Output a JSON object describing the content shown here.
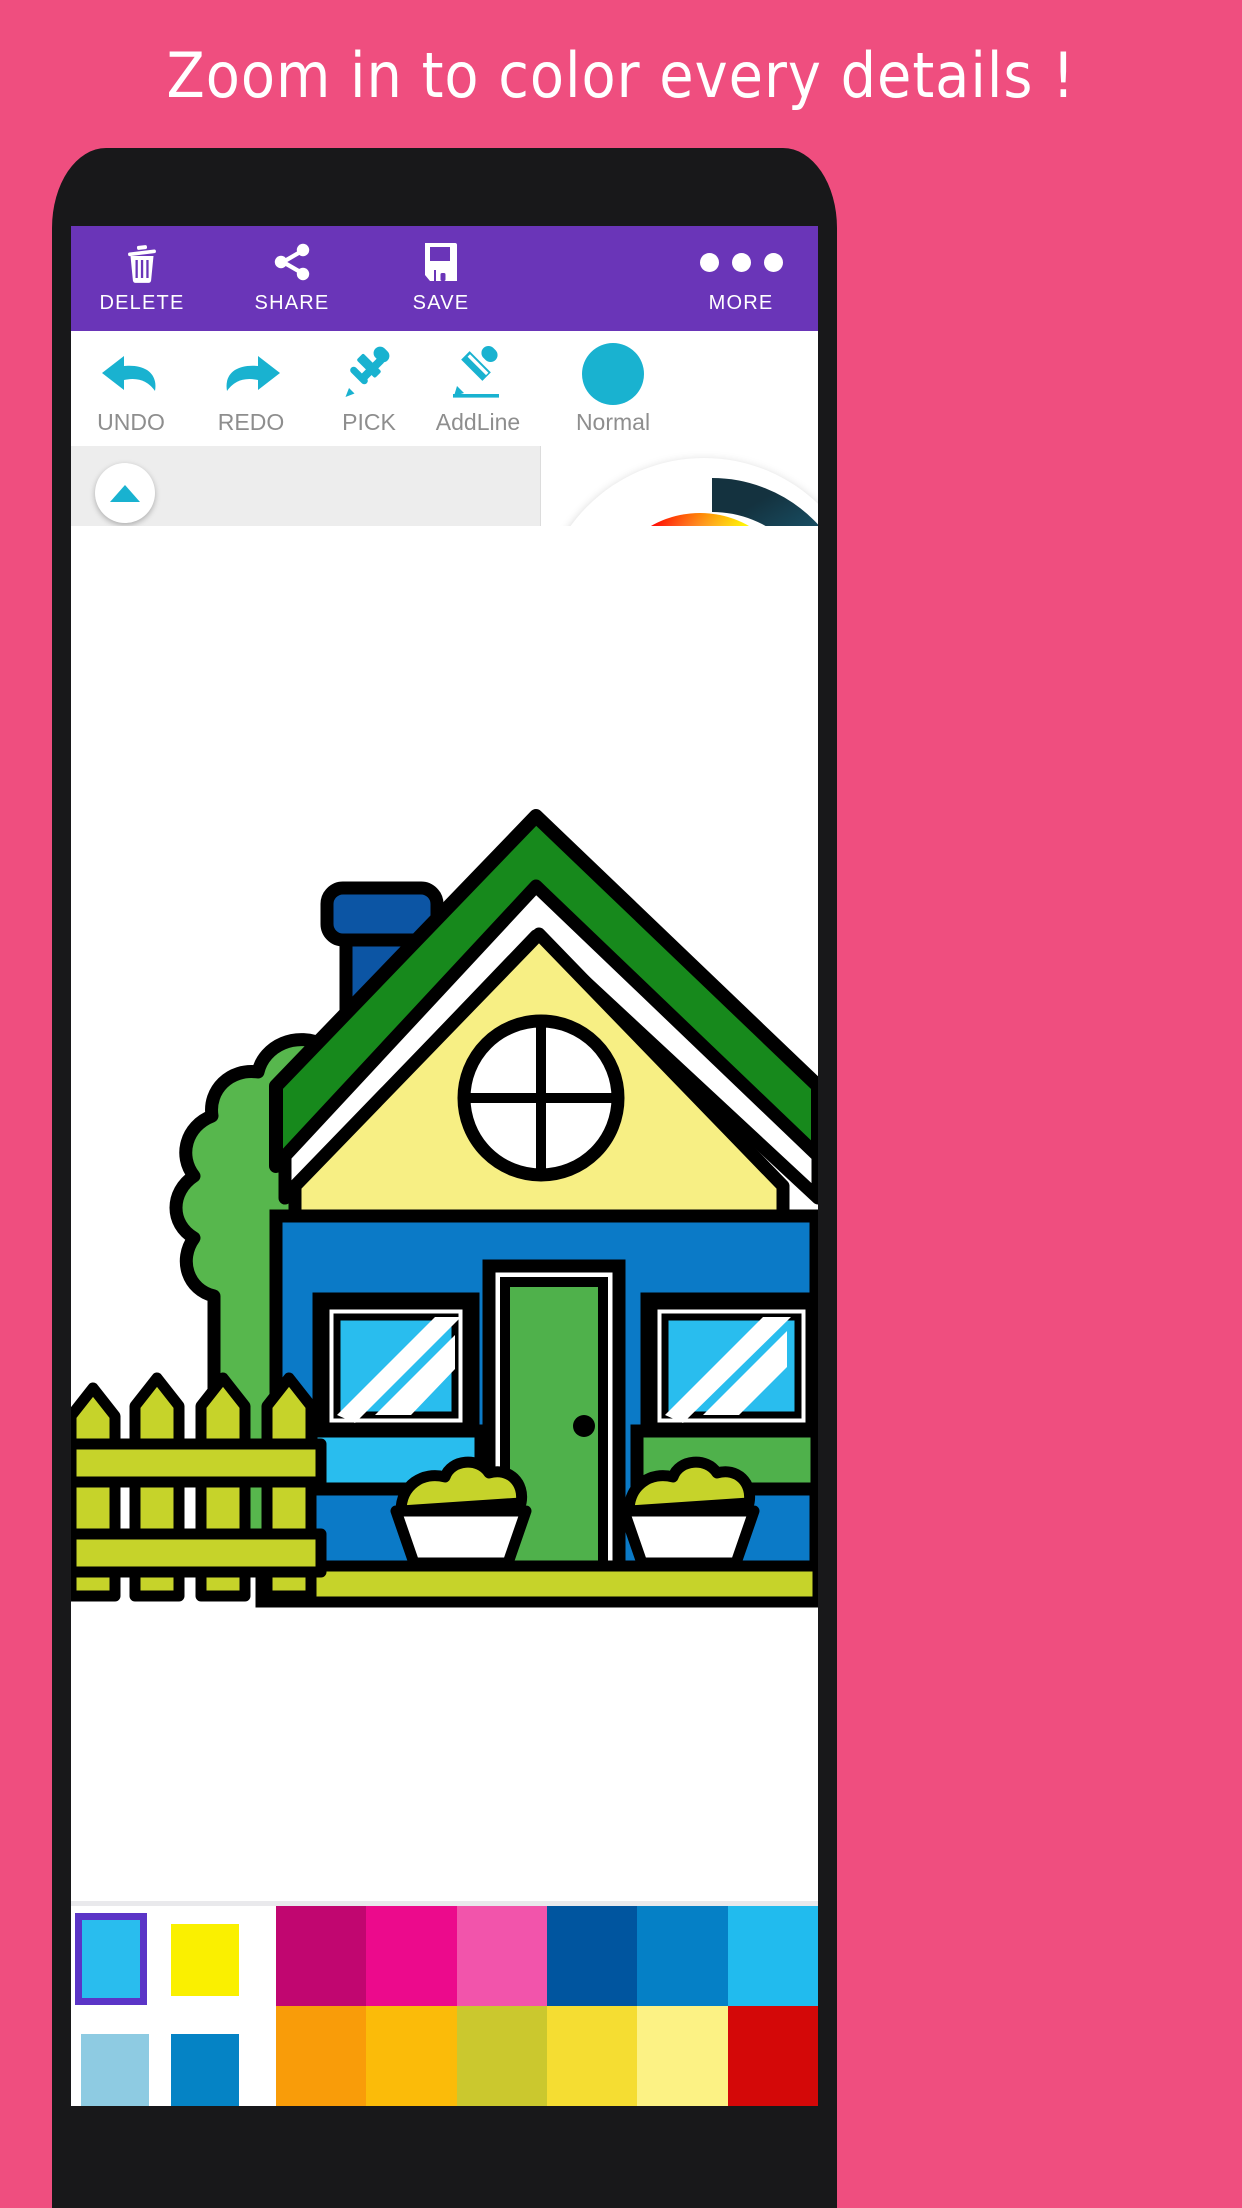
{
  "headline": {
    "text": "Zoom in to color every details !"
  },
  "colors": {
    "page_background": "#ef4e7f",
    "phone_body": "#18181a",
    "appbar_purple": "#6a35b8",
    "accent_cyan": "#19b2d0",
    "tool_label_grey": "#8e8e8e",
    "subbar_grey": "#ededed",
    "selection_purple": "#5b35c7"
  },
  "appbar": {
    "items": [
      {
        "id": "delete",
        "label": "DELETE",
        "icon": "trash-icon"
      },
      {
        "id": "share",
        "label": "SHARE",
        "icon": "share-icon"
      },
      {
        "id": "save",
        "label": "SAVE",
        "icon": "floppy-disk-icon"
      },
      {
        "id": "more",
        "label": "MORE",
        "icon": "overflow-dots-icon"
      }
    ]
  },
  "toolbar": {
    "items": [
      {
        "id": "undo",
        "label": "UNDO",
        "icon": "undo-arrow-icon"
      },
      {
        "id": "redo",
        "label": "REDO",
        "icon": "redo-arrow-icon"
      },
      {
        "id": "pick",
        "label": "PICK",
        "icon": "eyedropper-icon"
      },
      {
        "id": "addline",
        "label": "AddLine",
        "icon": "pencil-icon"
      },
      {
        "id": "normal",
        "label": "Normal",
        "icon": "filled-circle-icon",
        "swatch": "#19b2d0"
      }
    ]
  },
  "subbar": {
    "expand_icon": "triangle-up-icon"
  },
  "color_picker": {
    "type": "hsv-wheel",
    "selected_color": "#29b6e8",
    "wheel_marker_position": "right-of-center",
    "value_arc_from": "#14323f",
    "value_arc_to": "#35c1e8"
  },
  "artwork": {
    "title": "house-coloring-page",
    "fills": {
      "outline": "#000000",
      "roof": "#17891c",
      "roof_underside": "#ffffff",
      "gable": "#f7ef84",
      "wall": "#0b7ac7",
      "chimney": "#0c55a4",
      "door": "#4fb14b",
      "window_glass": "#29bdee",
      "window_box": "#29bdee",
      "window_box_right": "#4fb14b",
      "bush": "#57b74d",
      "fence": "#c6d32a",
      "porch": "#c6d32a",
      "planter_bowl": "#ffffff",
      "planter_plant": "#c6d32a",
      "round_window": "#ffffff"
    }
  },
  "palette": {
    "current_swatches": [
      {
        "color": "#29bdee",
        "selected": true
      },
      {
        "color": "#faf000",
        "selected": false
      },
      {
        "color": "#8ecbe2",
        "selected": false
      },
      {
        "color": "#0583c5",
        "selected": false
      }
    ],
    "grid": [
      "#c10670",
      "#ec0a8c",
      "#f254ab",
      "#00559f",
      "#0580c6",
      "#21bbee",
      "#f99c09",
      "#fbbb09",
      "#cbc82e",
      "#f5dd32",
      "#fcf284",
      "#d40808"
    ]
  }
}
